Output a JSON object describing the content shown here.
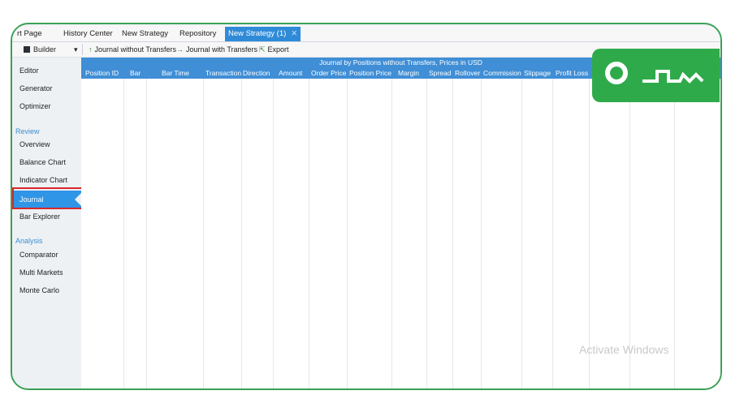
{
  "tabs": [
    {
      "label": "rt Page",
      "active": false
    },
    {
      "label": "History Center",
      "active": false
    },
    {
      "label": "New Strategy",
      "active": false
    },
    {
      "label": "Repository",
      "active": false
    },
    {
      "label": "New Strategy (1)",
      "active": true
    }
  ],
  "tab_close": "✕",
  "toolbar": {
    "builder_label": "Builder",
    "builder_chevron": "▾",
    "journal_without": "Journal without Transfers",
    "journal_with": "Journal with Transfers",
    "export": "Export"
  },
  "sidebar": {
    "items_top": [
      "Editor",
      "Generator",
      "Optimizer"
    ],
    "review_head": "Review",
    "review_items": [
      "Overview",
      "Balance Chart",
      "Indicator Chart",
      "Journal",
      "Bar Explorer"
    ],
    "analysis_head": "Analysis",
    "analysis_items": [
      "Comparator",
      "Multi Markets",
      "Monte Carlo"
    ]
  },
  "grid": {
    "title": "Journal by Positions without Transfers, Prices in USD",
    "columns": [
      "Position ID",
      "Bar",
      "Bar Time",
      "Transaction",
      "Direction",
      "Amount",
      "Order Price",
      "Position Price",
      "Margin",
      "Spread",
      "Rollover",
      "Commission",
      "Slippage",
      "Profit Loss"
    ]
  },
  "watermark": "Activate Windows",
  "logo": {
    "text": "SOODUP"
  },
  "colors": {
    "accent": "#2f8bd8",
    "frame": "#3aa055",
    "highlight": "#d8262d",
    "logo_bg": "#2faa4a"
  }
}
